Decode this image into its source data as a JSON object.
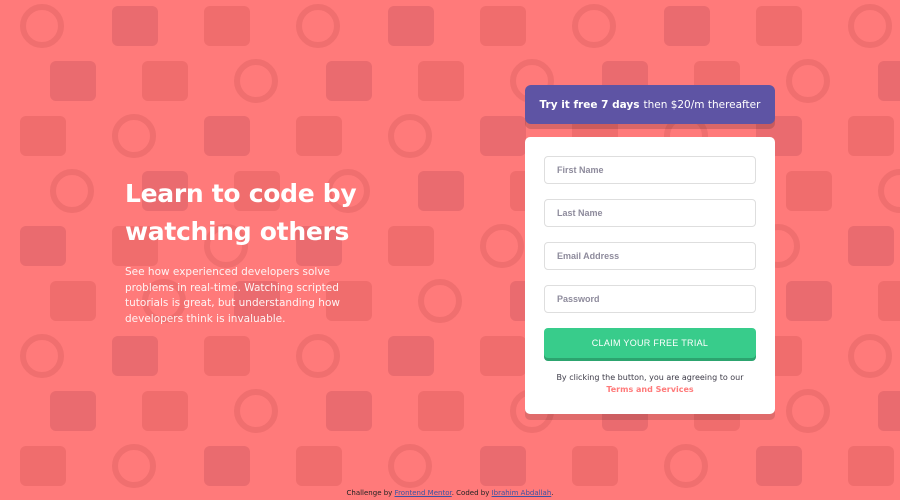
{
  "hero": {
    "title_line1": "Learn to code by",
    "title_line2": "watching others",
    "description": "See how experienced developers solve problems in real-time. Watching scripted tutorials is great, but understanding how developers think is invaluable."
  },
  "promo": {
    "bold": "Try it free 7 days",
    "rest": "then $20/m thereafter"
  },
  "form": {
    "first_name_placeholder": "First Name",
    "last_name_placeholder": "Last Name",
    "email_placeholder": "Email Address",
    "password_placeholder": "Password",
    "submit_label": "CLAIM YOUR FREE TRIAL",
    "terms_prefix": "By clicking the button, you are agreeing to our",
    "terms_link": "Terms and Services"
  },
  "attribution": {
    "prefix": "Challenge by",
    "challenge_link": "Frontend Mentor",
    "middle": ". Coded by",
    "author_link": "Ibrahim Abdallah",
    "suffix": "."
  },
  "colors": {
    "background": "#ff7a7a",
    "promo_bg": "#5e54a4",
    "submit_bg": "#38cc8b",
    "accent": "#ff7a7a"
  }
}
